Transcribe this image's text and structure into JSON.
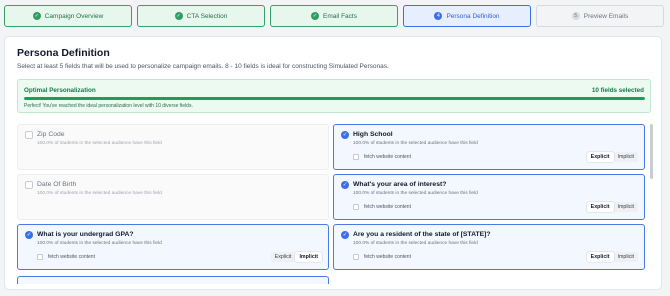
{
  "steps": [
    {
      "label": "Campaign Overview",
      "badge": "✓"
    },
    {
      "label": "CTA Selection",
      "badge": "✓"
    },
    {
      "label": "Email Facts",
      "badge": "✓"
    },
    {
      "label": "Persona Definition",
      "badge": "4"
    },
    {
      "label": "Preview Emails",
      "badge": "5"
    }
  ],
  "page": {
    "title": "Persona Definition",
    "subtitle": "Select at least 5 fields that will be used to personalize campaign emails. 8 - 10 fields is ideal for constructing Simulated Personas."
  },
  "optimal": {
    "title": "Optimal Personalization",
    "count": "10 fields selected",
    "message": "Perfect! You've reached the ideal personalization level with 10 diverse fields.",
    "progress_fraction": 1.0,
    "color": "#1f9d57"
  },
  "fields": [
    {
      "name": "Zip Code",
      "stat": "100.0% of students in the selected audience have this field",
      "selected": false
    },
    {
      "name": "High School",
      "stat": "100.0% of students in the selected audience have this field",
      "selected": true,
      "fetch": "fetch website content",
      "mode_explicit": "Explicit",
      "mode_implicit": "Implicit",
      "mode_selected": "Explicit"
    },
    {
      "name": "Date Of Birth",
      "stat": "100.0% of students in the selected audience have this field",
      "selected": false
    },
    {
      "name": "What's your area of interest?",
      "stat": "100.0% of students in the selected audience have this field",
      "selected": true,
      "fetch": "fetch website content",
      "mode_explicit": "Explicit",
      "mode_implicit": "Implicit",
      "mode_selected": "Explicit"
    },
    {
      "name": "What is your undergrad GPA?",
      "stat": "100.0% of students in the selected audience have this field",
      "selected": true,
      "fetch": "fetch website content",
      "mode_explicit": "Explicit",
      "mode_implicit": "Implicit",
      "mode_selected": "Implicit"
    },
    {
      "name": "Are you a resident of the state of [STATE]?",
      "stat": "100.0% of students in the selected audience have this field",
      "selected": true,
      "fetch": "fetch website content",
      "mode_explicit": "Explicit",
      "mode_implicit": "Implicit",
      "mode_selected": "Explicit"
    }
  ],
  "colors": {
    "accent": "#3b6ee8",
    "success": "#2f9e62"
  }
}
